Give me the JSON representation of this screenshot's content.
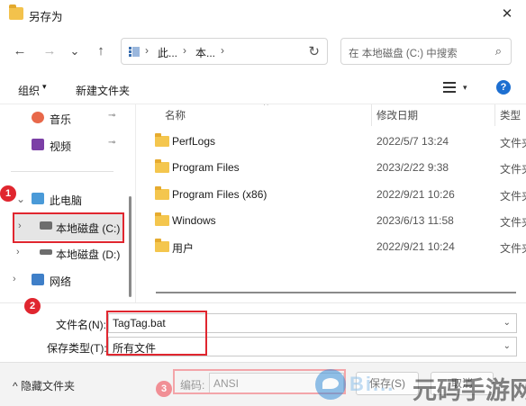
{
  "window": {
    "title": "另存为",
    "close_glyph": "✕"
  },
  "nav": {
    "back_glyph": "←",
    "forward_glyph": "→",
    "recent_glyph": "⌄",
    "up_glyph": "↑",
    "breadcrumb": [
      "此...",
      "本..."
    ],
    "breadcrumb_sep": "›",
    "refresh_glyph": "↻",
    "search_placeholder": "在 本地磁盘 (C:) 中搜索",
    "search_glyph": "⌕"
  },
  "toolbar": {
    "organize_label": "组织",
    "organize_caret": "▾",
    "new_folder_label": "新建文件夹",
    "view_caret": "▾",
    "help_glyph": "?"
  },
  "sidebar": {
    "items": [
      {
        "label": "音乐",
        "icon": "music-icon",
        "pinned": true
      },
      {
        "label": "视频",
        "icon": "video-icon",
        "pinned": true
      },
      {
        "label": "此电脑",
        "icon": "pc-icon",
        "expanded": true
      },
      {
        "label": "本地磁盘 (C:)",
        "icon": "drive-icon",
        "selected": true
      },
      {
        "label": "本地磁盘 (D:)",
        "icon": "drive-icon"
      },
      {
        "label": "网络",
        "icon": "network-icon"
      }
    ],
    "pin_glyph": "📌",
    "chevron_glyph": "›",
    "chevron_down_glyph": "⌄"
  },
  "filelist": {
    "columns": [
      "名称",
      "修改日期",
      "类型"
    ],
    "sort_glyph": "^",
    "rows": [
      {
        "name": "PerfLogs",
        "date": "2022/5/7 13:24",
        "type": "文件夹"
      },
      {
        "name": "Program Files",
        "date": "2023/2/22 9:38",
        "type": "文件夹"
      },
      {
        "name": "Program Files (x86)",
        "date": "2022/9/21 10:26",
        "type": "文件夹"
      },
      {
        "name": "Windows",
        "date": "2023/6/13 11:58",
        "type": "文件夹"
      },
      {
        "name": "用户",
        "date": "2022/9/21 10:24",
        "type": "文件夹"
      }
    ]
  },
  "form": {
    "filename_label": "文件名(N):",
    "filename_value": "TagTag.bat",
    "filetype_label": "保存类型(T):",
    "filetype_value": "所有文件",
    "dropdown_glyph": "⌄"
  },
  "footer": {
    "hide_folders_label": "隐藏文件夹",
    "hide_caret": "^",
    "encoding_label": "编码:",
    "encoding_value": "ANSI",
    "save_label": "保存(S)",
    "cancel_label": "取消"
  },
  "annotations": {
    "badge1": "1",
    "badge2": "2",
    "badge3": "3"
  },
  "colors": {
    "accent": "#1d6fd1",
    "highlight": "#e0262f",
    "folder": "#f4c64e"
  },
  "watermark": {
    "text1": "Bi...",
    "text2": "元码手游网"
  }
}
